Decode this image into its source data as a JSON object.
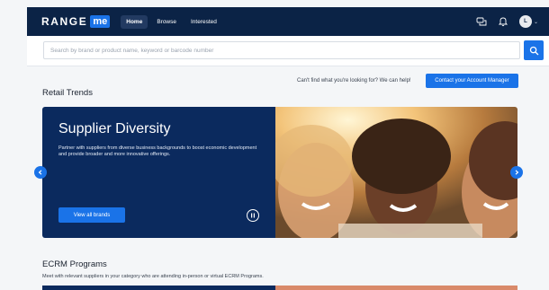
{
  "brand": {
    "logo_word": "RANGE",
    "logo_badge": "me"
  },
  "nav": {
    "tabs": [
      {
        "label": "Home",
        "active": true
      },
      {
        "label": "Browse",
        "active": false
      },
      {
        "label": "Interested",
        "active": false
      }
    ],
    "icons": [
      "chat-icon",
      "bell-icon"
    ],
    "avatar_initial": "L"
  },
  "search": {
    "placeholder": "Search by brand or product name, keyword or barcode number",
    "value": ""
  },
  "account_manager": {
    "prompt": "Can't find what you're looking for? We can help!",
    "button_label": "Contact your Account Manager"
  },
  "retail_trends": {
    "title": "Retail Trends",
    "slide": {
      "title": "Supplier Diversity",
      "description": "Partner with suppliers from diverse business backgrounds to boost economic development and provide broader and more innovative offerings.",
      "button_label": "View all brands"
    }
  },
  "ecrm_programs": {
    "title": "ECRM Programs",
    "description": "Meet with relevant suppliers in your category who are attending in-person or virtual ECRM Programs."
  },
  "colors": {
    "nav_bg": "#0b2346",
    "accent": "#1a73e8",
    "hero_panel": "#0b2a5e",
    "page_bg": "#f4f6f8"
  }
}
